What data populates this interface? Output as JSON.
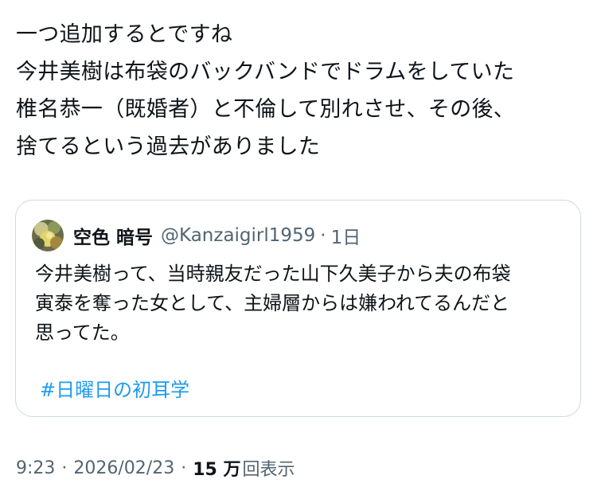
{
  "tweet": {
    "lines": [
      "一つ追加するとですね",
      "今井美樹は布袋のバックバンドでドラムをしていた",
      "椎名恭一（既婚者）と不倫して別れさせ、その後、",
      "捨てるという過去がありました"
    ]
  },
  "quote": {
    "display_name": "空色 暗号",
    "handle": "@Kanzaigirl1959",
    "separator": "·",
    "age": "1日",
    "lines": [
      "今井美樹って、当時親友だった山下久美子から夫の布袋",
      "寅泰を奪った女として、主婦層からは嫌われてるんだと",
      "思ってた。"
    ],
    "hashtag": "#日曜日の初耳学",
    "avatar_icon": "avatar-photo"
  },
  "meta": {
    "time": "9:23",
    "sep1": "·",
    "date": "2026/02/23",
    "sep2": "·",
    "views_count": "15 万",
    "views_label": "回表示"
  }
}
